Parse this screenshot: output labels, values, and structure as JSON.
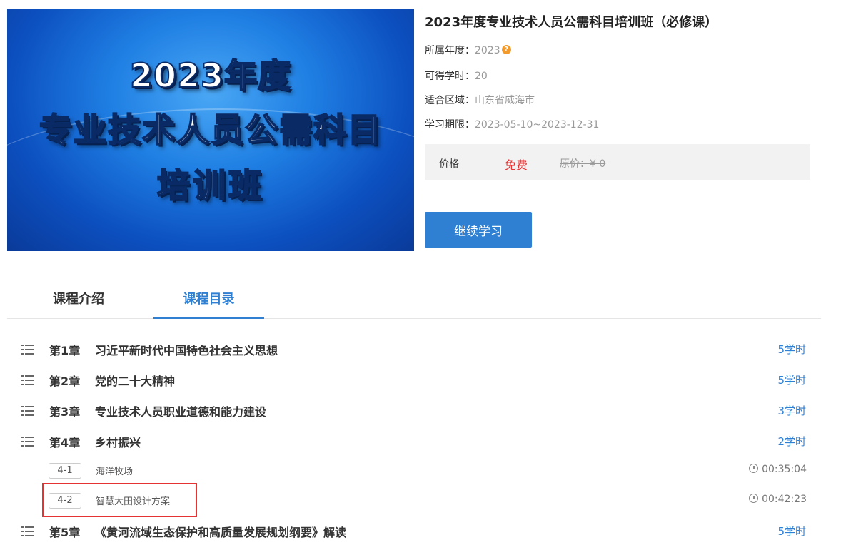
{
  "banner": {
    "line1": "2023年度",
    "line2": "专业技术人员公需科目",
    "line3": "培训班"
  },
  "course": {
    "title": "2023年度专业技术人员公需科目培训班（必修课）",
    "year_label": "所属年度：",
    "year_value": "2023",
    "hours_label": "可得学时：",
    "hours_value": "20",
    "region_label": "适合区域：",
    "region_value": "山东省威海市",
    "period_label": "学习期限：",
    "period_value": "2023-05-10~2023-12-31",
    "price_label": "价格",
    "price_value": "免费",
    "original_price": "原价：¥ 0",
    "continue_button": "继续学习"
  },
  "tabs": {
    "intro": "课程介绍",
    "catalog": "课程目录",
    "active": "catalog"
  },
  "chapters": [
    {
      "num": "第1章",
      "title": "习近平新时代中国特色社会主义思想",
      "hours": "5学时"
    },
    {
      "num": "第2章",
      "title": "党的二十大精神",
      "hours": "5学时"
    },
    {
      "num": "第3章",
      "title": "专业技术人员职业道德和能力建设",
      "hours": "3学时"
    },
    {
      "num": "第4章",
      "title": "乡村振兴",
      "hours": "2学时"
    },
    {
      "num": "第5章",
      "title": "《黄河流域生态保护和高质量发展规划纲要》解读",
      "hours": "5学时"
    }
  ],
  "lessons": [
    {
      "num": "4-1",
      "title": "海洋牧场",
      "duration": "00:35:04"
    },
    {
      "num": "4-2",
      "title": "智慧大田设计方案",
      "duration": "00:42:23"
    }
  ],
  "colors": {
    "accent": "#2f7fd3",
    "price_red": "#e53333",
    "highlight_red": "#e53333"
  }
}
